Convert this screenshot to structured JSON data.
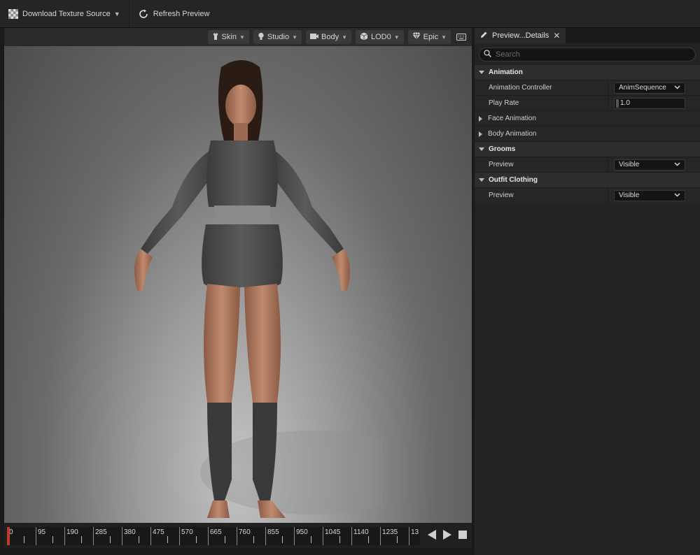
{
  "toolbar": {
    "download_label": "Download Texture Source",
    "refresh_label": "Refresh Preview"
  },
  "viewport": {
    "buttons": [
      {
        "label": "Skin",
        "icon": "skin-icon"
      },
      {
        "label": "Studio",
        "icon": "light-bulb-icon"
      },
      {
        "label": "Body",
        "icon": "body-icon"
      },
      {
        "label": "LOD0",
        "icon": "lod-cube-icon"
      },
      {
        "label": "Epic",
        "icon": "diamond-quality-icon"
      }
    ]
  },
  "timeline": {
    "labels": [
      "0",
      "95",
      "190",
      "285",
      "380",
      "475",
      "570",
      "665",
      "760",
      "855",
      "950",
      "1045",
      "1140",
      "1235",
      "13"
    ]
  },
  "details": {
    "tab_title": "Preview...Details",
    "search_placeholder": "Search",
    "sections": {
      "animation": {
        "title": "Animation",
        "controller_label": "Animation Controller",
        "controller_value": "AnimSequence",
        "play_rate_label": "Play Rate",
        "play_rate_value": "1.0",
        "face_animation": "Face Animation",
        "body_animation": "Body Animation"
      },
      "grooms": {
        "title": "Grooms",
        "preview_label": "Preview",
        "preview_value": "Visible"
      },
      "outfit": {
        "title": "Outfit Clothing",
        "preview_label": "Preview",
        "preview_value": "Visible"
      }
    }
  },
  "colors": {
    "accent": "#1e7fd6",
    "playhead": "#c0392b"
  }
}
